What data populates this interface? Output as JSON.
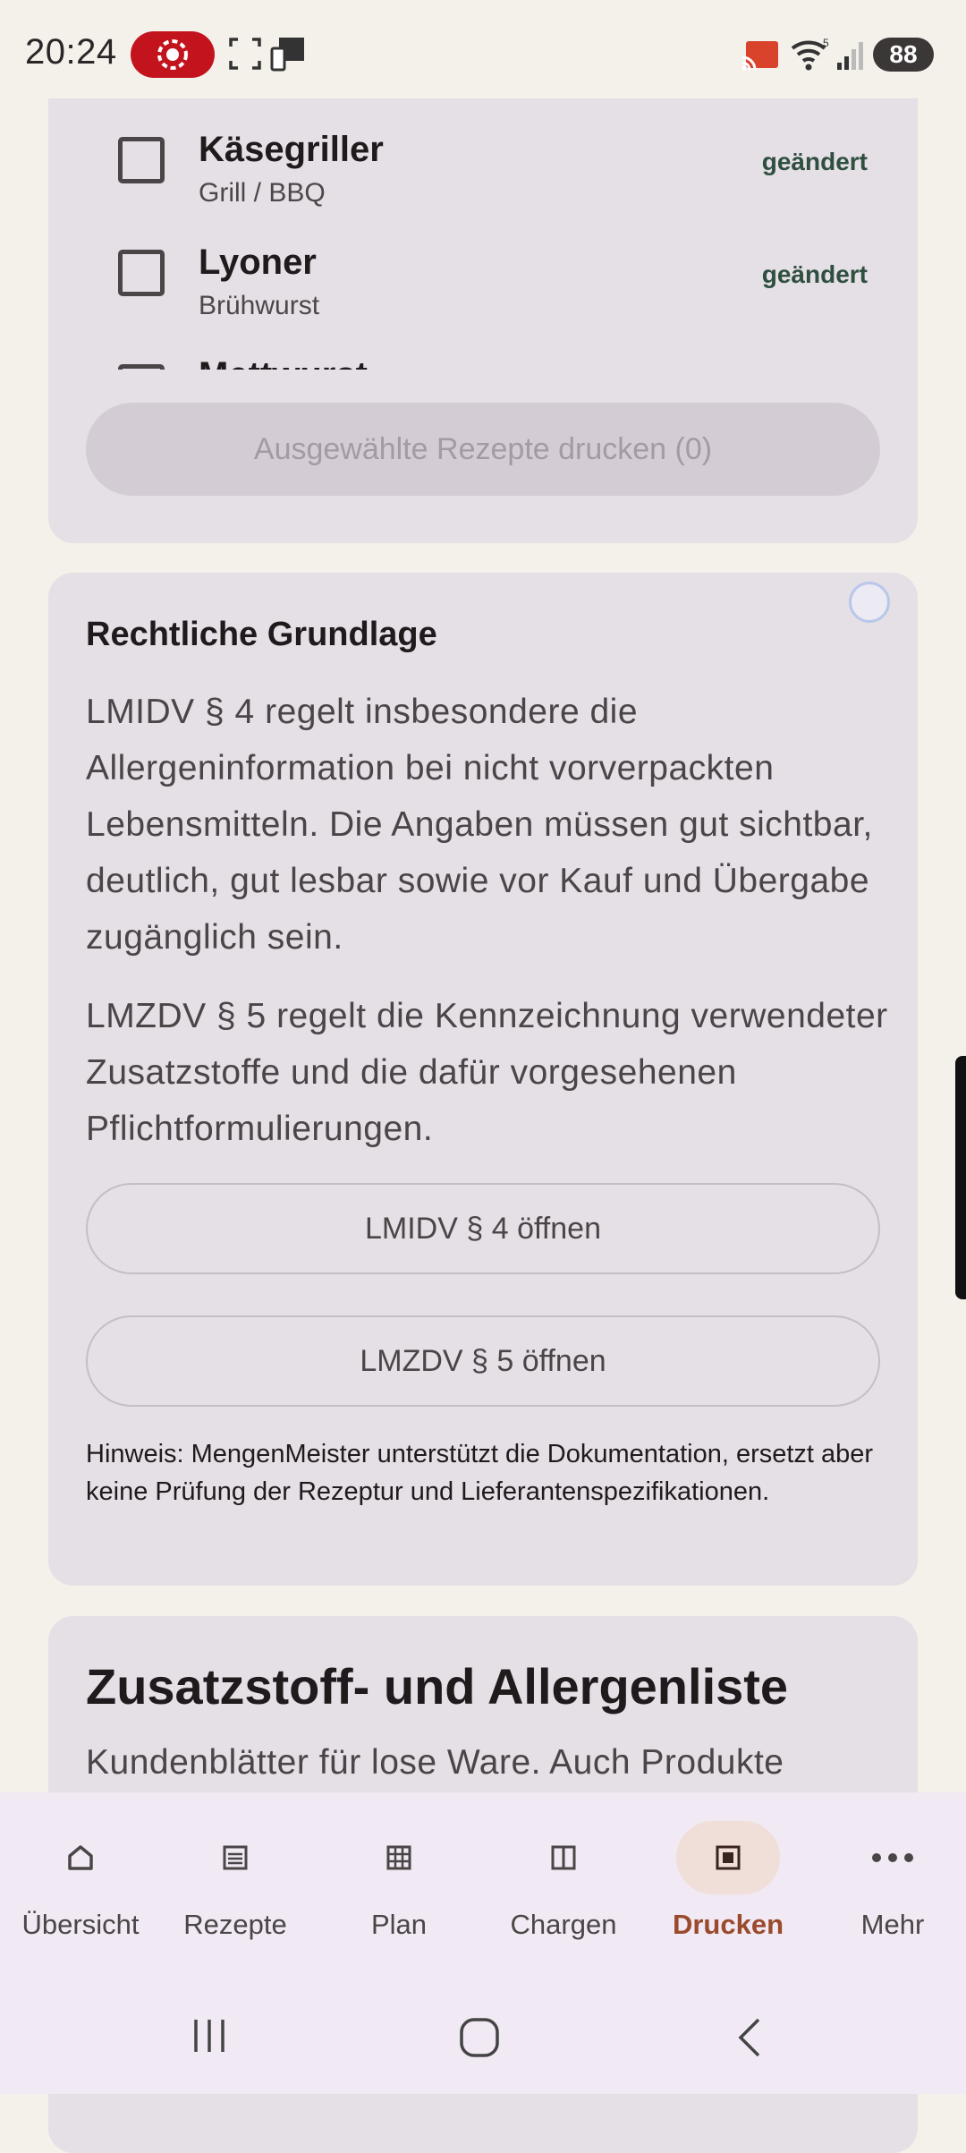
{
  "status_bar": {
    "time": "20:24",
    "battery": "88",
    "icons": [
      "record-icon",
      "screenshot-icon",
      "device-icon",
      "cast-icon",
      "wifi-icon",
      "signal-icon"
    ]
  },
  "recipes": {
    "items": [
      {
        "name": "Käsegriller",
        "category": "Grill / BBQ",
        "status": "geändert",
        "checked": false
      },
      {
        "name": "Lyoner",
        "category": "Brühwurst",
        "status": "geändert",
        "checked": false
      },
      {
        "name": "Mettwurst",
        "category": "",
        "status": "",
        "checked": false
      }
    ],
    "print_button": "Ausgewählte Rezepte drucken (0)"
  },
  "legal": {
    "title": "Rechtliche Grundlage",
    "paragraph1": "LMIDV § 4 regelt insbesondere die Allergeninformation bei nicht vorverpackten Lebensmitteln. Die Angaben müssen gut sichtbar, deutlich, gut lesbar sowie vor Kauf und Übergabe zugänglich sein.",
    "paragraph2": "LMZDV § 5 regelt die Kennzeichnung verwendeter Zusatzstoffe und die dafür vorgesehenen Pflichtformulierungen.",
    "button_lmidv": "LMIDV § 4 öffnen",
    "button_lmzdv": "LMZDV § 5 öffnen",
    "hint": "Hinweis: MengenMeister unterstützt die Dokumentation, ersetzt aber keine Prüfung der Rezeptur und Lieferantenspezifikationen."
  },
  "additive_list": {
    "title": "Zusatzstoff- und Allergenliste",
    "subtitle": "Kundenblätter für lose Ware. Auch Produkte"
  },
  "bottom_nav": {
    "active": "Drucken",
    "items": [
      {
        "label": "Übersicht",
        "icon": "home-icon"
      },
      {
        "label": "Rezepte",
        "icon": "list-icon"
      },
      {
        "label": "Plan",
        "icon": "grid-icon"
      },
      {
        "label": "Chargen",
        "icon": "columns-icon"
      },
      {
        "label": "Drucken",
        "icon": "print-icon"
      },
      {
        "label": "Mehr",
        "icon": "more-icon"
      }
    ]
  },
  "system_nav": {
    "buttons": [
      "recents-icon",
      "home-circle-icon",
      "back-icon"
    ]
  }
}
